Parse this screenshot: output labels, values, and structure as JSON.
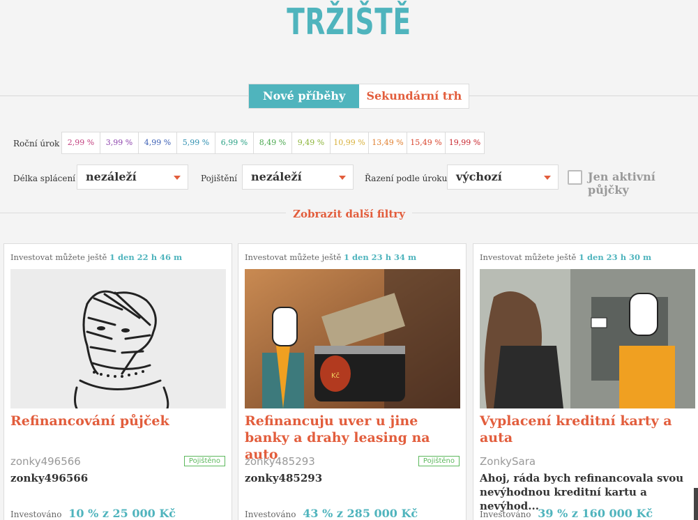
{
  "header": {
    "title": "TRŽIŠTĚ"
  },
  "tabs": [
    {
      "label": "Nové příběhy",
      "active": true
    },
    {
      "label": "Sekundární trh",
      "active": false
    }
  ],
  "filters": {
    "rate_label": "Roční úrok",
    "rates": [
      {
        "label": "2,99 %",
        "color": "#c2407f"
      },
      {
        "label": "3,99 %",
        "color": "#8e44ad"
      },
      {
        "label": "4,99 %",
        "color": "#3b5fb5"
      },
      {
        "label": "5,99 %",
        "color": "#2e8fb0"
      },
      {
        "label": "6,99 %",
        "color": "#28a084"
      },
      {
        "label": "8,49 %",
        "color": "#4aa84f"
      },
      {
        "label": "9,49 %",
        "color": "#8cb43a"
      },
      {
        "label": "10,99 %",
        "color": "#d8b03a"
      },
      {
        "label": "13,49 %",
        "color": "#e07f2f"
      },
      {
        "label": "15,49 %",
        "color": "#d9452d"
      },
      {
        "label": "19,99 %",
        "color": "#c8232b"
      }
    ],
    "term_label": "Délka splácení",
    "term_value": "nezáleží",
    "insurance_label": "Pojištění",
    "insurance_value": "nezáleží",
    "sort_label": "Řazení podle úroku",
    "sort_value": "výchozí",
    "active_only_label": "Jen aktivní půjčky",
    "more_filters": "Zobrazit další filtry"
  },
  "cards": [
    {
      "timer_prefix": "Investovat můžete ještě",
      "timer": "1 den 22 h 46 m",
      "title": "Refinancování půjček",
      "user": "zonky496566",
      "badge": "Pojištěno",
      "description": "zonky496566",
      "invested_label": "Investováno",
      "invested": "10 % z 25 000 Kč"
    },
    {
      "timer_prefix": "Investovat můžete ještě",
      "timer": "1 den 23 h 34 m",
      "title": "Refinancuju uver u jine banky a drahy leasing na auto",
      "user": "zonky485293",
      "badge": "Pojištěno",
      "description": "zonky485293",
      "invested_label": "Investováno",
      "invested": "43 % z 285 000 Kč"
    },
    {
      "timer_prefix": "Investovat můžete ještě",
      "timer": "1 den 23 h 30 m",
      "title": "Vyplacení kreditní karty a auta",
      "user": "ZonkySara",
      "description": "Ahoj, ráda bych refinancovala svou nevýhodnou kreditní kartu a nevýhod...",
      "invested_label": "Investováno",
      "invested": "39 % z 160 000 Kč"
    }
  ],
  "colors": {
    "accent": "#4fb4bd",
    "orange": "#e25d3c",
    "insured": "#5cb85c"
  }
}
